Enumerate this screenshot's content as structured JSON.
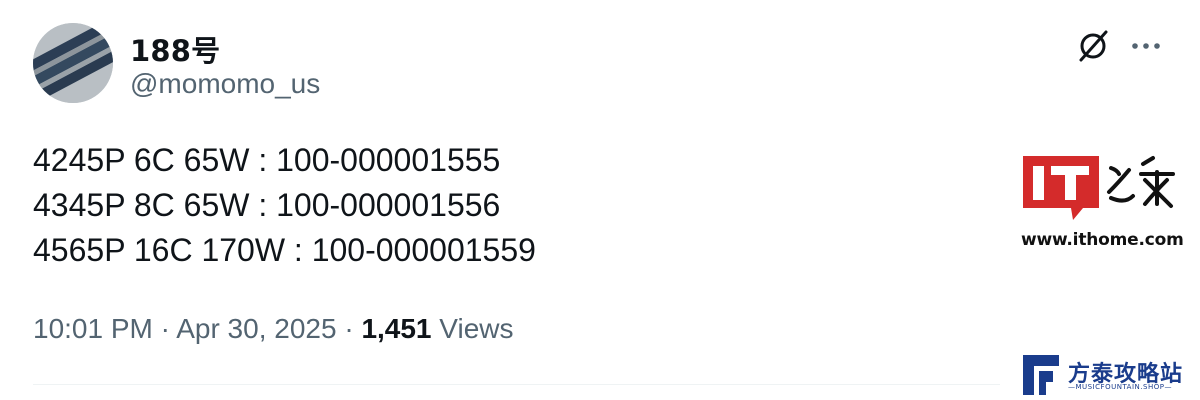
{
  "tweet": {
    "author": {
      "display_name": "188号",
      "handle": "@momomo_us"
    },
    "lines": [
      "4245P 6C 65W : 100-000001555",
      "4345P 8C 65W : 100-000001556",
      "4565P 16C 170W : 100-000001559"
    ],
    "time": "10:01 PM",
    "separator": "·",
    "date": "Apr 30, 2025",
    "views_count": "1,451",
    "views_label": "Views"
  },
  "icons": {
    "grok": "grok-icon",
    "more": "more-icon"
  },
  "watermarks": {
    "ithome_url": "www.ithome.com",
    "ithome_logo_text": "IT之家",
    "site_name": "方泰攻略站",
    "site_sub": "—MUSICFOUNTAIN.SHOP—"
  },
  "colors": {
    "text_primary": "#0f1419",
    "text_secondary": "#536471",
    "ithome_red": "#d42b2b",
    "site_blue": "#1a3c8c"
  }
}
